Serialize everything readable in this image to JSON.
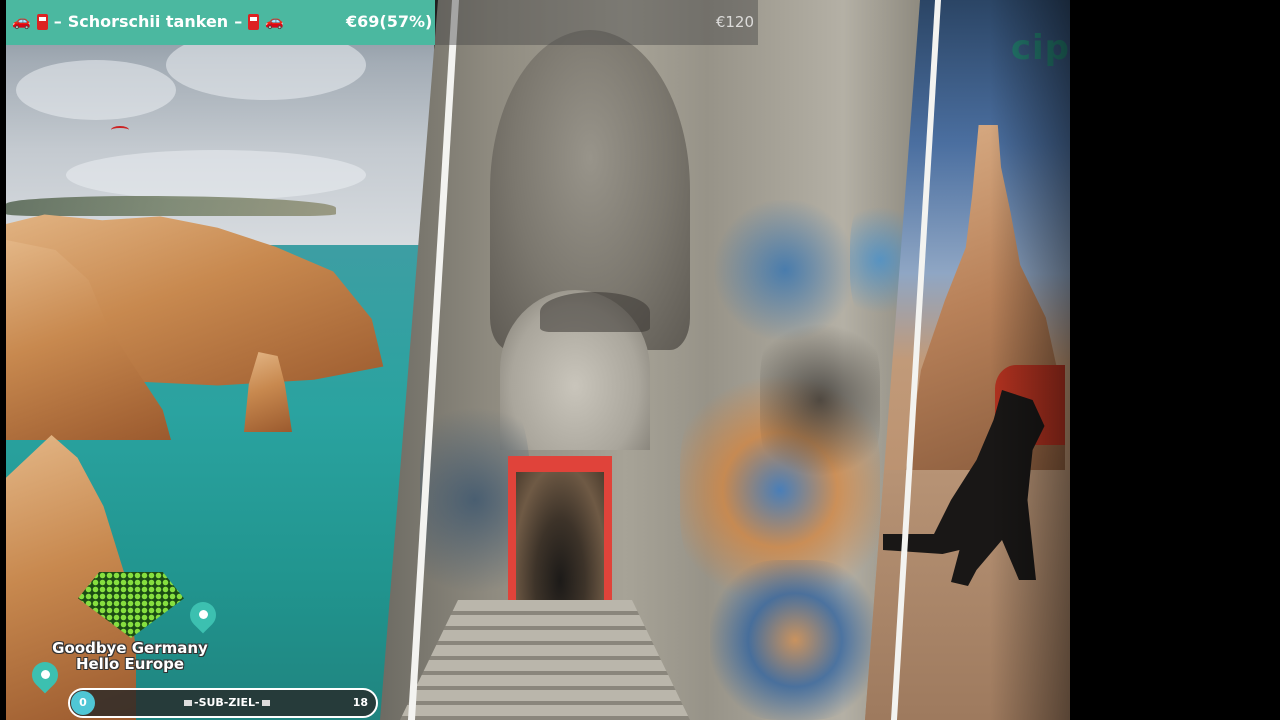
{
  "fuel_bar": {
    "title": "Schorschii tanken",
    "separator": "–",
    "amount": "€69(57%)",
    "goal": "€120",
    "progress": 0.57,
    "fill_color": "#4bb8a0",
    "icons": [
      "car-icon",
      "fuel-pump-icon"
    ]
  },
  "logo": {
    "line1": "Goodbye Germany",
    "line2": "Hello Europe",
    "pin_color": "#3cc0b0"
  },
  "sub_bar": {
    "current": "0",
    "label": "-SUB-ZIEL-",
    "goal": "18",
    "dot_color": "#4fc6d5"
  },
  "watermark": {
    "text": "cip"
  },
  "photos": [
    {
      "subject": "coastal-cliffs"
    },
    {
      "subject": "graffiti-tunnel"
    },
    {
      "subject": "rock-spire-with-dog"
    }
  ]
}
